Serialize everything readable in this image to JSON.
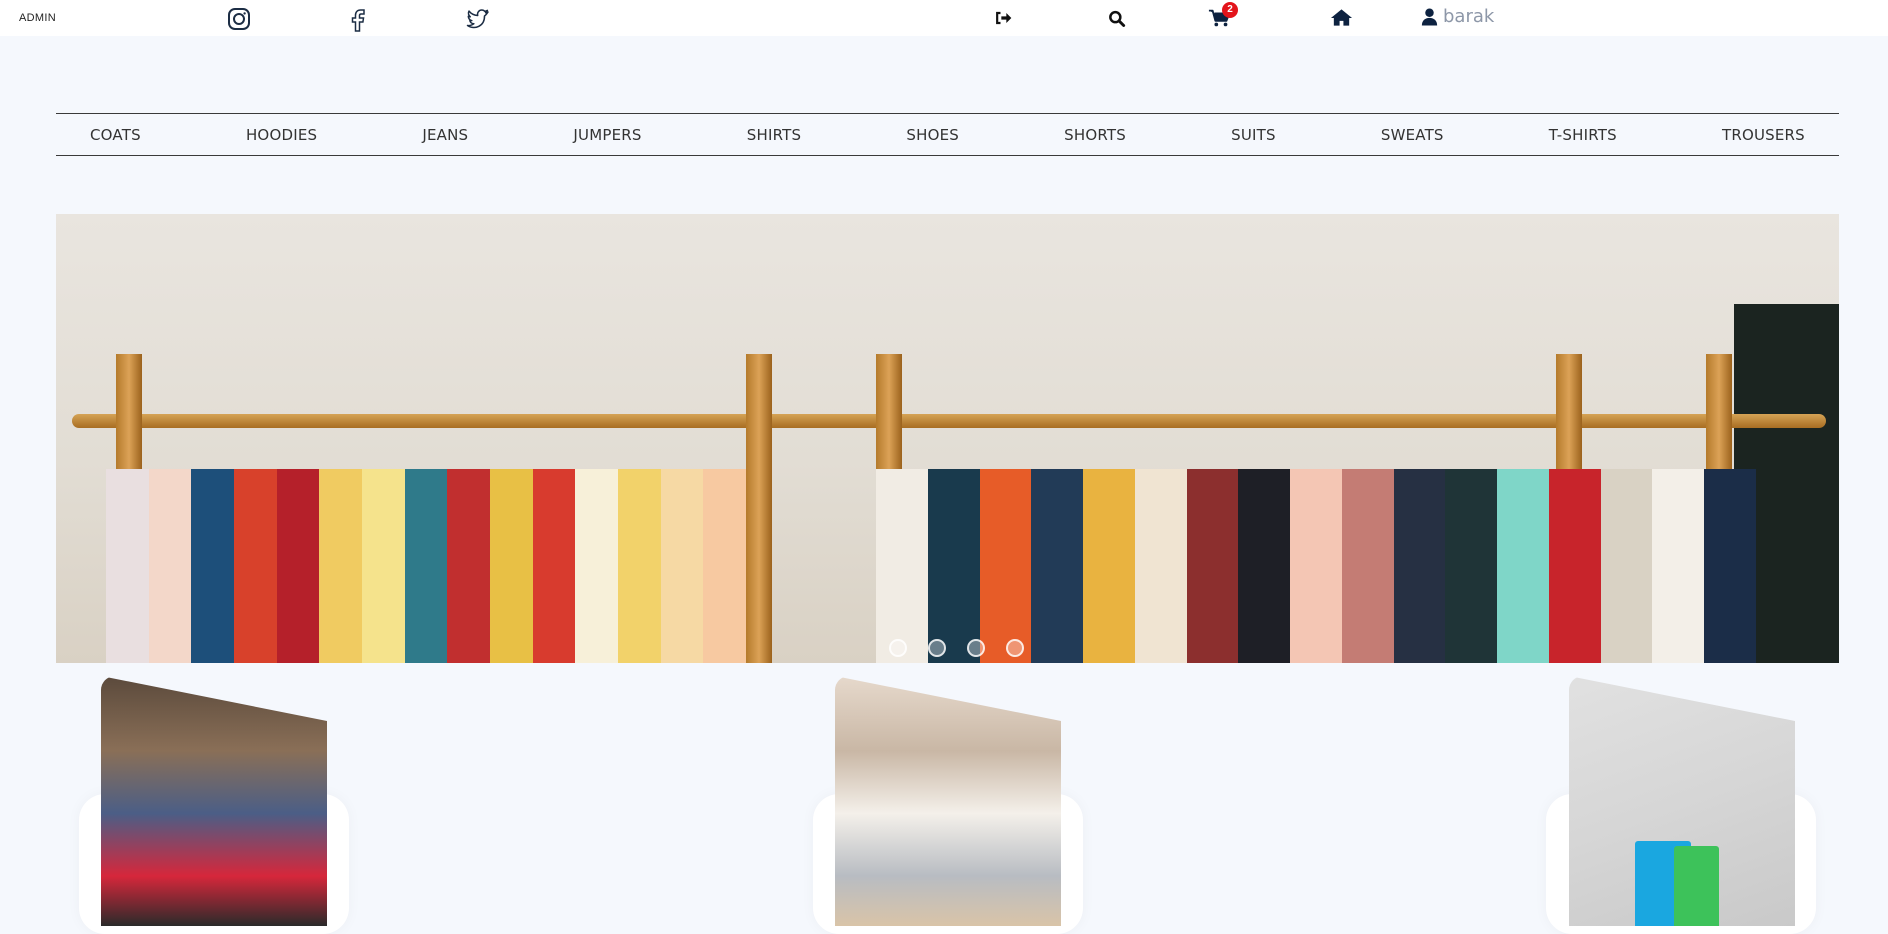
{
  "header": {
    "admin_label": "ADMIN",
    "cart_count": "2",
    "user_name": "barak",
    "icons": [
      "instagram-icon",
      "facebook-icon",
      "twitter-icon",
      "sign-out-icon",
      "search-icon",
      "cart-icon",
      "home-icon",
      "user-icon"
    ]
  },
  "categories": [
    "COATS",
    "HOODIES",
    "JEANS",
    "JUMPERS",
    "SHIRTS",
    "SHOES",
    "SHORTS",
    "SUITS",
    "SWEATS",
    "T-SHIRTS",
    "TROUSERS"
  ],
  "carousel": {
    "slide_count": 4
  },
  "colors": {
    "accent": "#0d2240",
    "badge": "#e3141b",
    "background": "#f5f8fd"
  }
}
